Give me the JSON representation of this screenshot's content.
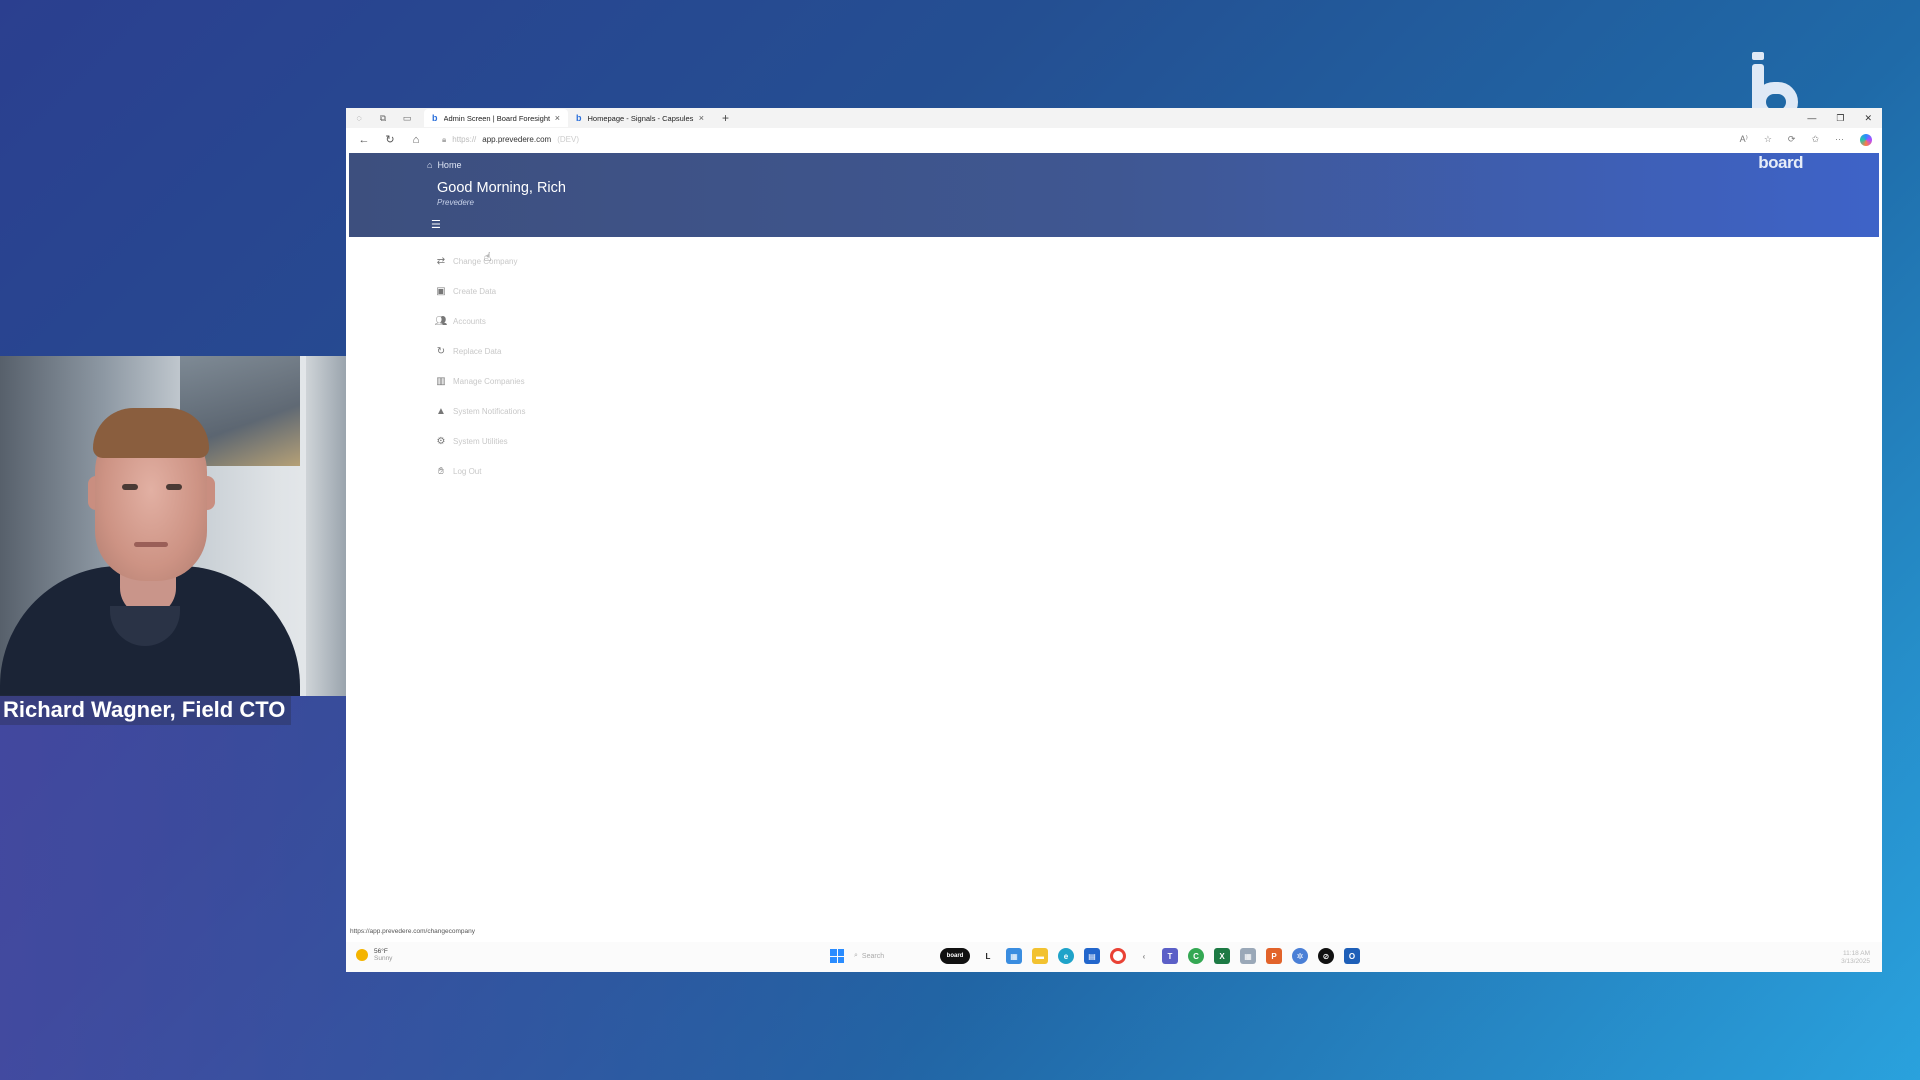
{
  "browser": {
    "tabs": [
      {
        "title": "Admin Screen | Board Foresight",
        "favicon": "b"
      },
      {
        "title": "Homepage - Signals - Capsules |",
        "favicon": "b"
      }
    ],
    "close_glyph": "×",
    "newtab_glyph": "+",
    "address": {
      "protocol": "https://",
      "host": "app.prevedere.com",
      "env": "(DEV)"
    },
    "status_url": "https://app.prevedere.com/changecompany"
  },
  "app": {
    "breadcrumb": "Home",
    "greeting": "Good Morning, Rich",
    "company": "Prevedere",
    "logo": "board",
    "menu": [
      {
        "label": "Change Company",
        "icon": "swap-icon"
      },
      {
        "label": "Create Data",
        "icon": "calendar-plus-icon"
      },
      {
        "label": "Accounts",
        "icon": "users-icon"
      },
      {
        "label": "Replace Data",
        "icon": "refresh-icon"
      },
      {
        "label": "Manage Companies",
        "icon": "building-icon"
      },
      {
        "label": "System Notifications",
        "icon": "warning-icon"
      },
      {
        "label": "System Utilities",
        "icon": "gear-icon"
      },
      {
        "label": "Log Out",
        "icon": "hand-icon"
      }
    ]
  },
  "taskbar": {
    "weather_temp": "56°F",
    "weather_desc": "Sunny",
    "search_placeholder": "Search",
    "board_app": "board",
    "time": "11:18 AM",
    "date": "3/13/2025"
  },
  "presenter": {
    "name_title": "Richard Wagner, Field CTO"
  },
  "colors": {
    "header_start": "#3d4f7e",
    "header_end": "#3e63c8",
    "background_start": "#2b3f8f",
    "background_end": "#2aa7e0"
  }
}
